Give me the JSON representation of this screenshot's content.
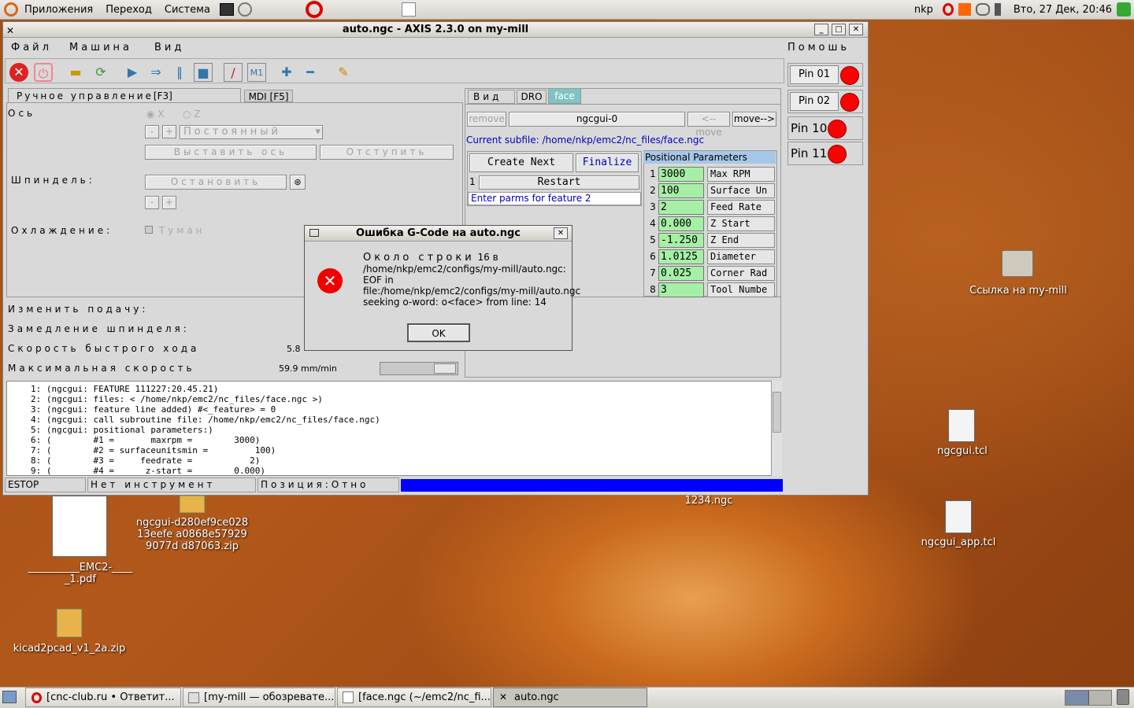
{
  "panel": {
    "menus": [
      "Приложения",
      "Переход",
      "Система"
    ],
    "user": "nkp",
    "clock": "Вто, 27 Дек, 20:46"
  },
  "window": {
    "title": "auto.ngc - AXIS 2.3.0 on my-mill",
    "menu": [
      "Файл",
      "Машина",
      "Вид"
    ],
    "help": "Помошь"
  },
  "tabs": {
    "manual": "Ручное управление",
    "manual_key": "[F3]",
    "mdi": "MDI [F5]"
  },
  "manual": {
    "axis_label": "Ось",
    "axis_x": "X",
    "axis_z": "Z",
    "minus": "-",
    "plus": "+",
    "jog_mode": "Постоянный",
    "set_axis": "Выставить ось",
    "offset": "Отступить",
    "spindle_label": "Шпиндель:",
    "stop": "Остановить",
    "cooling_label": "Охлаждение:",
    "mist": "Туман"
  },
  "overrides": {
    "feed": "Изменить подачу:",
    "spindle": "Замедление шпинделя:",
    "rapid": "Скорость быстрого хода",
    "rapid_val": "5.8",
    "maxvel": "Максимальная скорость",
    "maxvel_val": "59.9 mm/min"
  },
  "right_tabs": {
    "view": "Вид",
    "dro": "DRO",
    "face": "face"
  },
  "ngcgui": {
    "remove": "remove",
    "name": "ngcgui-0",
    "move_left": "<--move",
    "move_right": "move-->",
    "subfile": "Current subfile: /home/nkp/emc2/nc_files/face.ngc",
    "create_next": "Create Next",
    "finalize": "Finalize",
    "restart_num": "1",
    "restart": "Restart",
    "hint": "Enter parms for feature 2",
    "params_title": "Positional Parameters",
    "params": [
      {
        "n": "1",
        "v": "3000",
        "l": "Max RPM"
      },
      {
        "n": "2",
        "v": "100",
        "l": "Surface Un"
      },
      {
        "n": "3",
        "v": "2",
        "l": "Feed Rate"
      },
      {
        "n": "4",
        "v": "0.000",
        "l": "Z Start"
      },
      {
        "n": "5",
        "v": "-1.250",
        "l": "Z End"
      },
      {
        "n": "6",
        "v": "1.0125",
        "l": "Diameter"
      },
      {
        "n": "7",
        "v": "0.025",
        "l": "Corner Rad"
      },
      {
        "n": "8",
        "v": "3",
        "l": "Tool Numbe"
      }
    ]
  },
  "gcode_lines": [
    "1: (ngcgui: FEATURE 111227:20.45.21)",
    "2: (ngcgui: files: < /home/nkp/emc2/nc_files/face.ngc >)",
    "3: (ngcgui: feature line added) #<_feature> = 0",
    "4: (ngcgui: call subroutine file: /home/nkp/emc2/nc_files/face.ngc)",
    "5: (ngcgui: positional parameters:)",
    "6: (        #1 =       maxrpm =        3000)",
    "7: (        #2 = surfaceunitsmin =         100)",
    "8: (        #3 =     feedrate =           2)",
    "9: (        #4 =      z-start =        0.000)"
  ],
  "status": {
    "estop": "ESTOP",
    "tool": "Нет инструмент",
    "position": "Позиция:Отно"
  },
  "pins": [
    "Pin 01",
    "Pin 02",
    "Pin 10",
    "Pin 11"
  ],
  "dialog": {
    "title": "Ошибка G-Code на auto.ngc",
    "line1a": "Около строки",
    "line1b": "16 в",
    "line2": "/home/nkp/emc2/configs/my-mill/auto.ngc:",
    "line3": "EOF in",
    "line4": "file:/home/nkp/emc2/configs/my-mill/auto.ngc",
    "line5": "seeking o-word: o<face> from line: 14",
    "ok": "OK"
  },
  "desktop": {
    "link": "Ссылка на my-mill",
    "tcl1": "ngcgui.tcl",
    "tcl2": "ngcgui_app.tcl",
    "ngc": "1234.ngc",
    "zip": "ngcgui-d280ef9ce02813eefe a0868e579299077d d87063.zip",
    "pdf": "__________EMC2-____ _1.pdf",
    "kicad": "kicad2pcad_v1_2a.zip"
  },
  "taskbar": [
    "[cnc-club.ru • Ответит...",
    "[my-mill — обозревате...",
    "[face.ngc (~/emc2/nc_fi...",
    "auto.ngc"
  ],
  "colors": {
    "led": "#ff0000",
    "progress": "#0000ff",
    "green_field": "#a6f0a6"
  }
}
